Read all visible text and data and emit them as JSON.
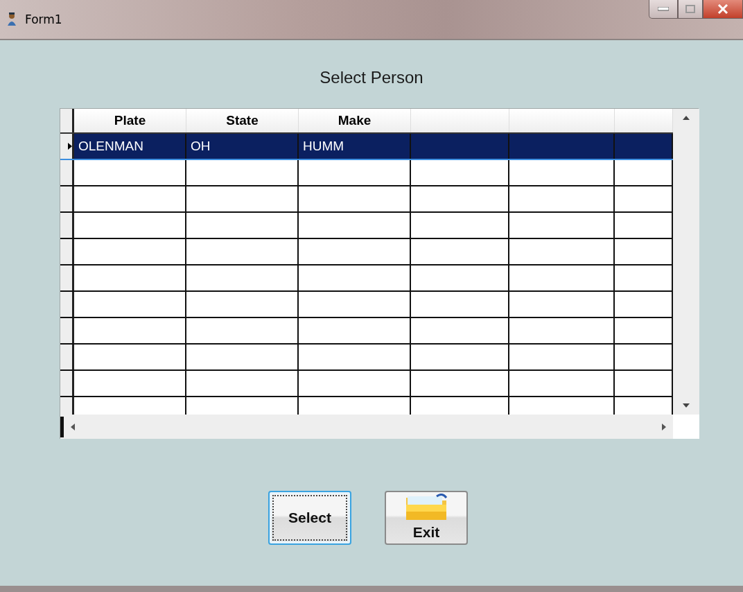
{
  "window": {
    "title": "Form1"
  },
  "heading": "Select Person",
  "table": {
    "columns": [
      "Plate",
      "State",
      "Make"
    ],
    "rows": [
      {
        "cells": [
          "OLENMAN",
          "OH",
          "HUMM"
        ],
        "selected": true
      }
    ]
  },
  "buttons": [
    {
      "label": "Select",
      "kind": "text",
      "focused": true
    },
    {
      "label": "Exit",
      "kind": "folder",
      "focused": false
    }
  ]
}
